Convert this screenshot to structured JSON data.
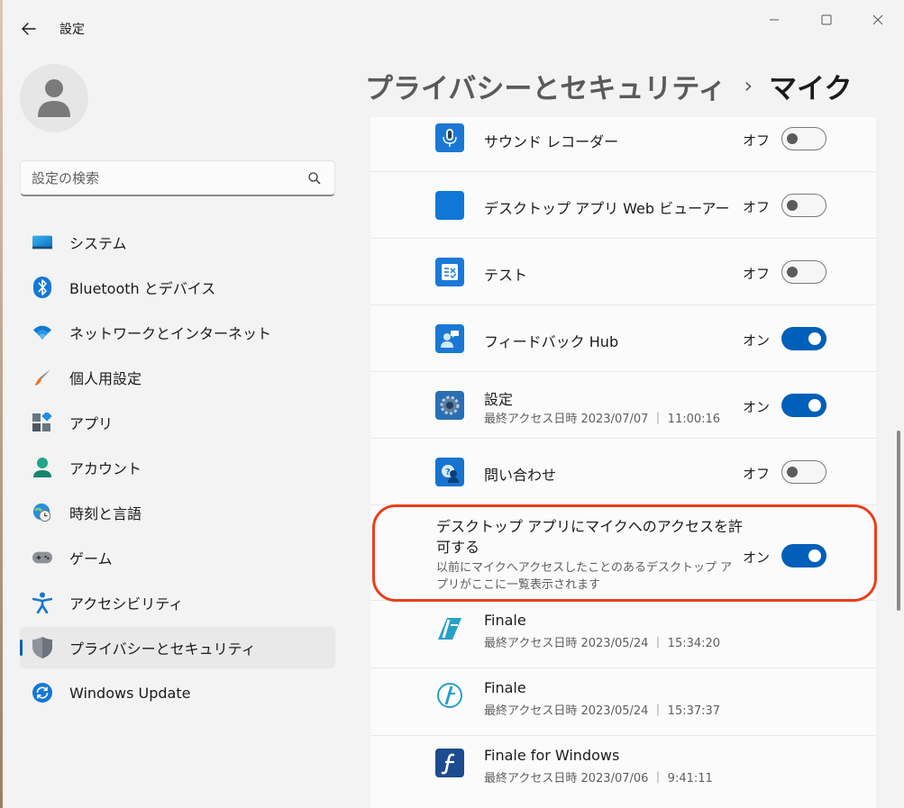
{
  "window": {
    "app_title": "設定"
  },
  "search": {
    "placeholder": "設定の検索"
  },
  "sidebar": {
    "items": [
      {
        "label": "システム",
        "icon": "system-icon"
      },
      {
        "label": "Bluetooth とデバイス",
        "icon": "bluetooth-icon"
      },
      {
        "label": "ネットワークとインターネット",
        "icon": "wifi-icon"
      },
      {
        "label": "個人用設定",
        "icon": "brush-icon"
      },
      {
        "label": "アプリ",
        "icon": "apps-icon"
      },
      {
        "label": "アカウント",
        "icon": "account-icon"
      },
      {
        "label": "時刻と言語",
        "icon": "globe-clock-icon"
      },
      {
        "label": "ゲーム",
        "icon": "gamepad-icon"
      },
      {
        "label": "アクセシビリティ",
        "icon": "accessibility-icon"
      },
      {
        "label": "プライバシーとセキュリティ",
        "icon": "shield-icon",
        "active": true
      },
      {
        "label": "Windows Update",
        "icon": "update-icon"
      }
    ]
  },
  "header": {
    "parent": "プライバシーとセキュリティ",
    "separator": "›",
    "current": "マイク"
  },
  "apps": [
    {
      "name": "サウンド レコーダー",
      "state": "オフ",
      "on": false
    },
    {
      "name": "デスクトップ アプリ Web ビューアー",
      "state": "オフ",
      "on": false
    },
    {
      "name": "テスト",
      "state": "オフ",
      "on": false
    },
    {
      "name": "フィードバック Hub",
      "state": "オン",
      "on": true
    },
    {
      "name": "設定",
      "sub": "最終アクセス日時 2023/07/07 ｜ 11:00:16",
      "state": "オン",
      "on": true
    },
    {
      "name": "問い合わせ",
      "state": "オフ",
      "on": false
    }
  ],
  "desktop_access": {
    "title": "デスクトップ アプリにマイクへのアクセスを許可する",
    "description": "以前にマイクへアクセスしたことのあるデスクトップ アプリがここに一覧表示されます",
    "state": "オン",
    "on": true
  },
  "desktop_apps": [
    {
      "name": "Finale",
      "sub": "最終アクセス日時 2023/05/24 ｜ 15:34:20"
    },
    {
      "name": "Finale",
      "sub": "最終アクセス日時 2023/05/24 ｜ 15:37:37"
    },
    {
      "name": "Finale for Windows",
      "sub": "最終アクセス日時 2023/07/06 ｜ 9:41:11"
    }
  ],
  "colors": {
    "accent": "#005fb8",
    "highlight_border": "#e8401c"
  }
}
